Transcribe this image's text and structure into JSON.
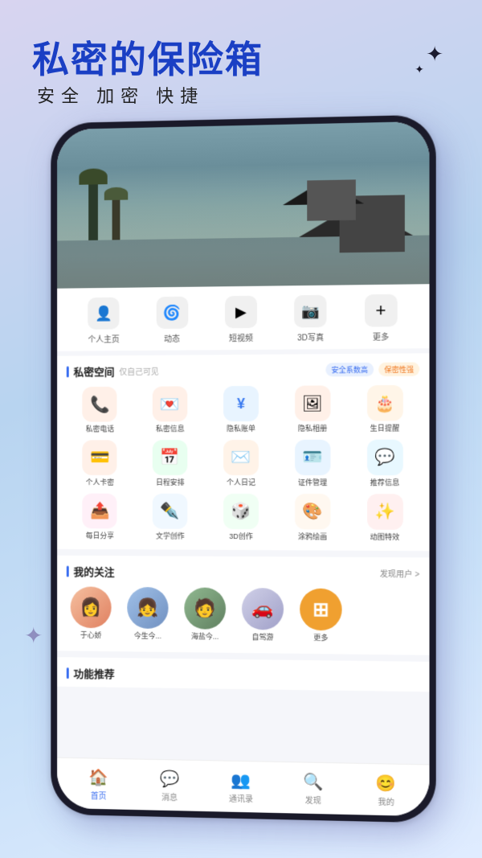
{
  "hero": {
    "title": "私密的保险箱",
    "subtitle": "安全   加密   快捷"
  },
  "nav_items": [
    {
      "icon": "👤",
      "label": "个人主页"
    },
    {
      "icon": "🌀",
      "label": "动态"
    },
    {
      "icon": "▶",
      "label": "短视频"
    },
    {
      "icon": "📷",
      "label": "3D写真"
    },
    {
      "icon": "+",
      "label": "更多"
    }
  ],
  "private_space": {
    "title": "私密空间",
    "subtitle": "仅自己可见",
    "badge_security": "安全系数高",
    "badge_privacy": "保密性强",
    "icons": [
      {
        "emoji": "📞",
        "label": "私密电话",
        "class": "icon-phone"
      },
      {
        "emoji": "💌",
        "label": "私密信息",
        "class": "icon-message"
      },
      {
        "emoji": "¥",
        "label": "隐私账单",
        "class": "icon-bill"
      },
      {
        "emoji": "🖼",
        "label": "隐私相册",
        "class": "icon-photo"
      },
      {
        "emoji": "🎂",
        "label": "生日提醒",
        "class": "icon-birthday"
      },
      {
        "emoji": "💳",
        "label": "个人卡密",
        "class": "icon-card"
      },
      {
        "emoji": "📅",
        "label": "日程安排",
        "class": "icon-schedule"
      },
      {
        "emoji": "✉",
        "label": "个人日记",
        "class": "icon-diary"
      },
      {
        "emoji": "🪪",
        "label": "证件管理",
        "class": "icon-cert"
      },
      {
        "emoji": "💬",
        "label": "推荐信息",
        "class": "icon-recommend"
      },
      {
        "emoji": "📤",
        "label": "每日分享",
        "class": "icon-share"
      },
      {
        "emoji": "✒",
        "label": "文学创作",
        "class": "icon-write"
      },
      {
        "emoji": "🎲",
        "label": "3D创作",
        "class": "icon-3d"
      },
      {
        "emoji": "🎨",
        "label": "涂鸦绘画",
        "class": "icon-paint"
      },
      {
        "emoji": "✨",
        "label": "动图特效",
        "class": "icon-anim"
      }
    ]
  },
  "following": {
    "title": "我的关注",
    "discover": "发现用户 >",
    "avatars": [
      {
        "name": "于心娇",
        "emoji": "👩"
      },
      {
        "name": "今生今...",
        "emoji": "👧"
      },
      {
        "name": "海盐今...",
        "emoji": "🧑"
      },
      {
        "name": "自驾游",
        "emoji": "🚗"
      },
      {
        "name": "更多",
        "emoji": "⊞"
      }
    ]
  },
  "recommend": {
    "title": "功能推荐"
  },
  "bottom_nav": [
    {
      "icon": "🏠",
      "label": "首页",
      "active": true
    },
    {
      "icon": "💬",
      "label": "消息",
      "active": false
    },
    {
      "icon": "👥",
      "label": "通讯录",
      "active": false
    },
    {
      "icon": "🔍",
      "label": "发现",
      "active": false
    },
    {
      "icon": "😊",
      "label": "我的",
      "active": false
    }
  ]
}
